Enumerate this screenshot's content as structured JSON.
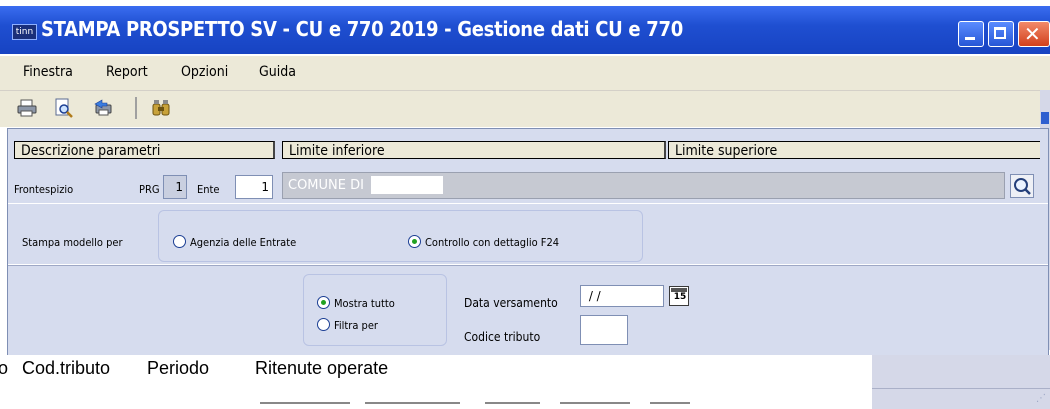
{
  "window": {
    "icon_text": "tinn",
    "title": "STAMPA PROSPETTO SV - CU e 770 2019 - Gestione dati CU e 770"
  },
  "menu": [
    "Finestra",
    "Report",
    "Opzioni",
    "Guida"
  ],
  "toolbar": {
    "icons": [
      "print-icon",
      "print-preview-icon",
      "export-icon",
      "search-binoculars-icon"
    ]
  },
  "grid_header": {
    "col1": "Descrizione parametri",
    "col2": "Limite inferiore",
    "col3": "Limite superiore"
  },
  "frontespizio": {
    "label": "Frontespizio",
    "prg_label": "PRG",
    "prg_value": "1",
    "ente_label": "Ente",
    "ente_value": "1",
    "comune": "COMUNE DI"
  },
  "stampa": {
    "label": "Stampa modello per",
    "option1": "Agenzia delle Entrate",
    "option2": "Controllo con dettaglio F24",
    "selected": "option2"
  },
  "filter": {
    "show_all": "Mostra tutto",
    "filter_by": "Filtra per",
    "selected": "show_all",
    "data_versamento_label": "Data versamento",
    "data_versamento_value": " / /",
    "codice_tributo_label": "Codice tributo",
    "codice_tributo_value": "",
    "calendar_day": "15"
  },
  "report_preview": {
    "col_partial": "o",
    "col_cod_tributo": "Cod.tributo",
    "col_periodo": "Periodo",
    "col_ritenute": "Ritenute operate"
  }
}
